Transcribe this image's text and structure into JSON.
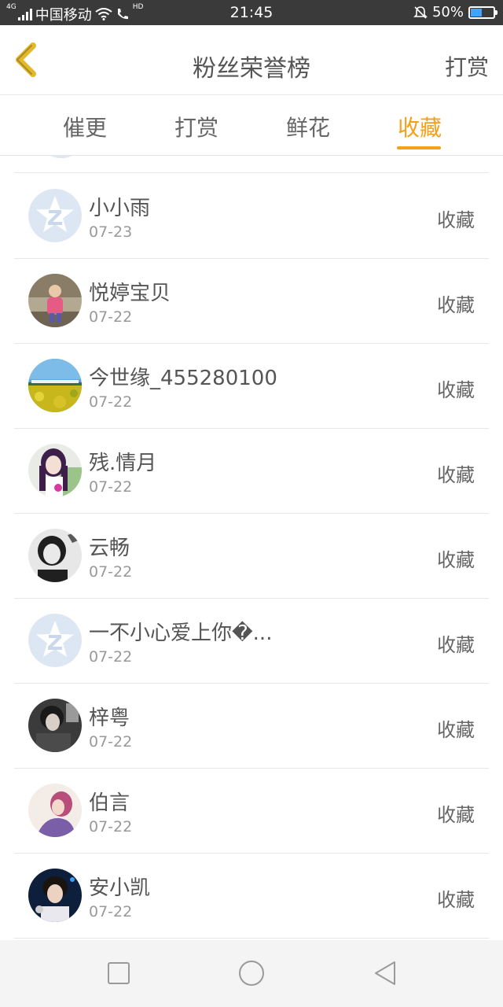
{
  "status_bar": {
    "network_tag": "4G",
    "carrier": "中国移动",
    "hd_tag": "HD",
    "time": "21:45",
    "battery_percent": "50%",
    "battery_level": 0.5,
    "icons": [
      "signal-icon",
      "wifi-icon",
      "phone-hd-icon",
      "mute-bell-icon",
      "battery-icon"
    ]
  },
  "header": {
    "title": "粉丝荣誉榜",
    "right_action": "打赏"
  },
  "tabs": [
    {
      "label": "催更",
      "active": false
    },
    {
      "label": "打赏",
      "active": false
    },
    {
      "label": "鲜花",
      "active": false
    },
    {
      "label": "收藏",
      "active": true
    }
  ],
  "colors": {
    "accent": "#f4a018",
    "text_primary": "#555555",
    "text_secondary": "#999999",
    "status_bar": "#3a3a3a"
  },
  "rows": [
    {
      "name": "小小雨",
      "date": "07-23",
      "type": "收藏",
      "avatar": "default-qq-avatar"
    },
    {
      "name": "悦婷宝贝",
      "date": "07-22",
      "type": "收藏",
      "avatar": "child-photo-avatar"
    },
    {
      "name": "今世缘_455280100",
      "date": "07-22",
      "type": "收藏",
      "avatar": "landscape-train-avatar"
    },
    {
      "name": "残.情月",
      "date": "07-22",
      "type": "收藏",
      "avatar": "girl-purple-hair-avatar"
    },
    {
      "name": "云畅",
      "date": "07-22",
      "type": "收藏",
      "avatar": "girl-bw-avatar"
    },
    {
      "name": "一不小心爱上你�...",
      "date": "07-22",
      "type": "收藏",
      "avatar": "default-qq-avatar"
    },
    {
      "name": "梓粤",
      "date": "07-22",
      "type": "收藏",
      "avatar": "boy-dark-avatar"
    },
    {
      "name": "伯言",
      "date": "07-22",
      "type": "收藏",
      "avatar": "girl-purple-avatar"
    },
    {
      "name": "安小凯",
      "date": "07-22",
      "type": "收藏",
      "avatar": "boy-mic-avatar"
    }
  ],
  "nav_bar": [
    "recent-apps-icon",
    "home-icon",
    "back-icon"
  ]
}
